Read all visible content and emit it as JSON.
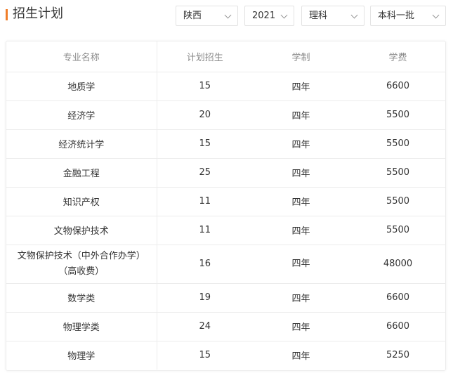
{
  "header": {
    "title": "招生计划",
    "accent_color": "#f07e2a"
  },
  "filters": {
    "province": "陕西",
    "year": "2021",
    "subject": "理科",
    "batch": "本科一批"
  },
  "table": {
    "columns": [
      "专业名称",
      "计划招生",
      "学制",
      "学费"
    ],
    "rows": [
      {
        "major": "地质学",
        "plan": "15",
        "duration": "四年",
        "tuition": "6600"
      },
      {
        "major": "经济学",
        "plan": "20",
        "duration": "四年",
        "tuition": "5500"
      },
      {
        "major": "经济统计学",
        "plan": "15",
        "duration": "四年",
        "tuition": "5500"
      },
      {
        "major": "金融工程",
        "plan": "25",
        "duration": "四年",
        "tuition": "5500"
      },
      {
        "major": "知识产权",
        "plan": "11",
        "duration": "四年",
        "tuition": "5500"
      },
      {
        "major": "文物保护技术",
        "plan": "11",
        "duration": "四年",
        "tuition": "5500"
      },
      {
        "major": "文物保护技术（中外合作办学）（高收费）",
        "plan": "16",
        "duration": "四年",
        "tuition": "48000"
      },
      {
        "major": "数学类",
        "plan": "19",
        "duration": "四年",
        "tuition": "6600"
      },
      {
        "major": "物理学类",
        "plan": "24",
        "duration": "四年",
        "tuition": "6600"
      },
      {
        "major": "物理学",
        "plan": "15",
        "duration": "四年",
        "tuition": "5250"
      }
    ]
  }
}
